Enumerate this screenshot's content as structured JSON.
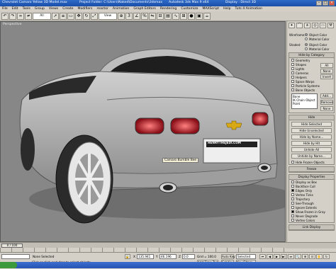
{
  "window": {
    "title": "Chevrolet Camaro Yellow 3D Model.max",
    "project": "Project Folder: C:\\Users\\Naked\\Documents\\3dsmax",
    "app": "Autodesk 3ds Max 9 x64",
    "display": "Display : Direct 3D"
  },
  "menu": [
    "File",
    "Edit",
    "Tools",
    "Group",
    "Views",
    "Create",
    "Modifiers",
    "reactor",
    "Animation",
    "Graph Editors",
    "Rendering",
    "Customize",
    "MAXScript",
    "Help",
    "Tuts 4 Animation"
  ],
  "toolbar": {
    "selection_filter": "All",
    "view": "View"
  },
  "viewport": {
    "label": "Perspective",
    "car_tag": "Camaro Bumble Bee",
    "plate_text": "HENRYTHEJEDI.COM"
  },
  "panel": {
    "wireframe_label": "Wireframe",
    "wireframe_opt1": "Object Color",
    "wireframe_opt2": "Material Color",
    "shaded_label": "Shaded",
    "shaded_opt1": "Object Color",
    "shaded_opt2": "Material Color",
    "hide_by_category": "Hide by Category",
    "categories": [
      "Geometry",
      "Shapes",
      "Lights",
      "Cameras",
      "Helpers",
      "Space Warps",
      "Particle Systems",
      "Bone Objects"
    ],
    "all": "All",
    "none": "None",
    "invert": "Invert",
    "add": "Add...",
    "remove": "Remove",
    "list_items": [
      "Bone",
      "IK Chain Object",
      "Point"
    ],
    "hide_rollout": "Hide",
    "hide_selected": "Hide Selected",
    "hide_unselected": "Hide Unselected",
    "hide_by_name": "Hide by Name...",
    "hide_by_hit": "Hide by Hit",
    "unhide_all": "Unhide All",
    "unhide_by_name": "Unhide by Name...",
    "hide_frozen": "Hide Frozen Objects",
    "freeze_rollout": "Freeze",
    "display_props": "Display Properties",
    "props": [
      "Display as Box",
      "Backface Cull",
      "Edges Only",
      "Vertex Ticks",
      "Trajectory",
      "See-Through",
      "Ignore Extents",
      "Show Frozen in Gray",
      "Never Degrade",
      "Vertex Colors"
    ],
    "link_display": "Link Display"
  },
  "timeline": {
    "frame": "0 / 100"
  },
  "status": {
    "message": "Click or click-and-drag to select objects",
    "selected": "None Selected",
    "x": "135.941",
    "y": "46.196",
    "z": "0.0",
    "grid": "Grid = 100.0",
    "autokey": "Auto Key",
    "setkey": "Set Key",
    "selected_dd": "Selected",
    "keyfilters": "Key Filters...",
    "add_time_tag": "Add Time Tag"
  }
}
